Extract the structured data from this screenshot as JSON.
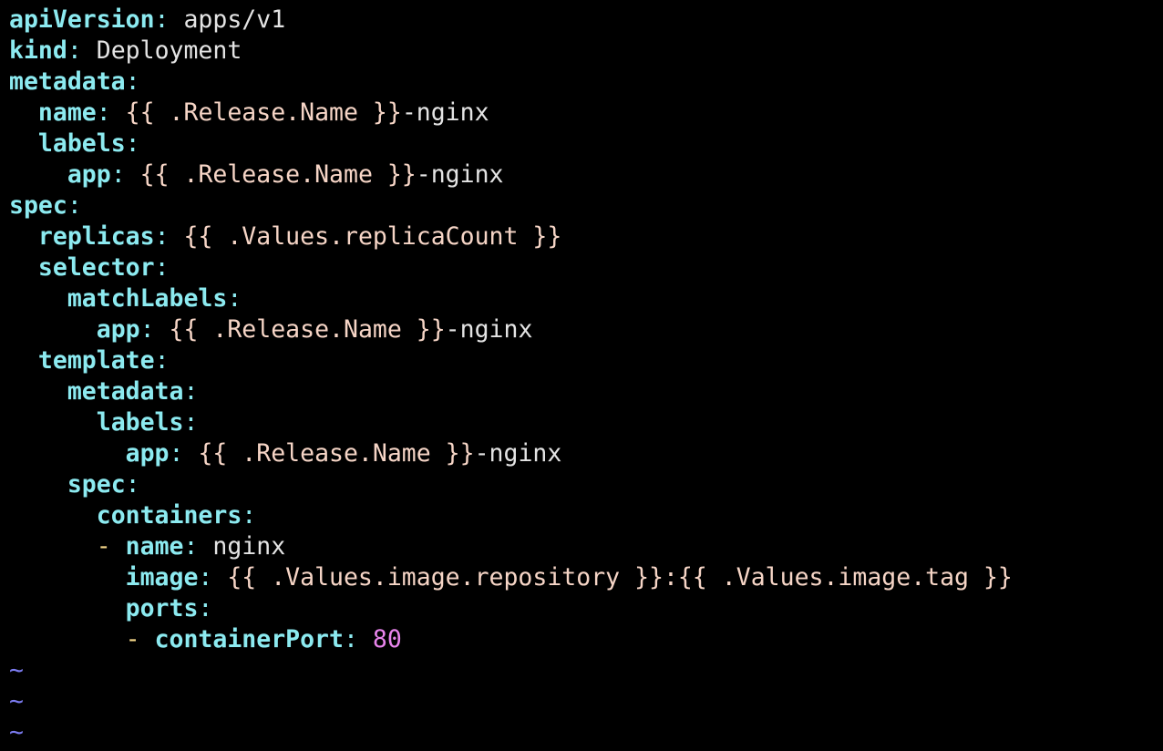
{
  "editor": {
    "lines": [
      {
        "indent": "",
        "dash": "",
        "key": "apiVersion",
        "colon": ":",
        "tpl": "",
        "value": " apps/v1",
        "number": ""
      },
      {
        "indent": "",
        "dash": "",
        "key": "kind",
        "colon": ":",
        "tpl": "",
        "value": " Deployment",
        "number": ""
      },
      {
        "indent": "",
        "dash": "",
        "key": "metadata",
        "colon": ":",
        "tpl": "",
        "value": "",
        "number": ""
      },
      {
        "indent": "  ",
        "dash": "",
        "key": "name",
        "colon": ":",
        "tpl": " {{ .Release.Name }}",
        "value": "-nginx",
        "number": ""
      },
      {
        "indent": "  ",
        "dash": "",
        "key": "labels",
        "colon": ":",
        "tpl": "",
        "value": "",
        "number": ""
      },
      {
        "indent": "    ",
        "dash": "",
        "key": "app",
        "colon": ":",
        "tpl": " {{ .Release.Name }}",
        "value": "-nginx",
        "number": ""
      },
      {
        "indent": "",
        "dash": "",
        "key": "spec",
        "colon": ":",
        "tpl": "",
        "value": "",
        "number": ""
      },
      {
        "indent": "  ",
        "dash": "",
        "key": "replicas",
        "colon": ":",
        "tpl": " {{ .Values.replicaCount }}",
        "value": "",
        "number": ""
      },
      {
        "indent": "  ",
        "dash": "",
        "key": "selector",
        "colon": ":",
        "tpl": "",
        "value": "",
        "number": ""
      },
      {
        "indent": "    ",
        "dash": "",
        "key": "matchLabels",
        "colon": ":",
        "tpl": "",
        "value": "",
        "number": ""
      },
      {
        "indent": "      ",
        "dash": "",
        "key": "app",
        "colon": ":",
        "tpl": " {{ .Release.Name }}",
        "value": "-nginx",
        "number": ""
      },
      {
        "indent": "  ",
        "dash": "",
        "key": "template",
        "colon": ":",
        "tpl": "",
        "value": "",
        "number": ""
      },
      {
        "indent": "    ",
        "dash": "",
        "key": "metadata",
        "colon": ":",
        "tpl": "",
        "value": "",
        "number": ""
      },
      {
        "indent": "      ",
        "dash": "",
        "key": "labels",
        "colon": ":",
        "tpl": "",
        "value": "",
        "number": ""
      },
      {
        "indent": "        ",
        "dash": "",
        "key": "app",
        "colon": ":",
        "tpl": " {{ .Release.Name }}",
        "value": "-nginx",
        "number": ""
      },
      {
        "indent": "    ",
        "dash": "",
        "key": "spec",
        "colon": ":",
        "tpl": "",
        "value": "",
        "number": ""
      },
      {
        "indent": "      ",
        "dash": "",
        "key": "containers",
        "colon": ":",
        "tpl": "",
        "value": "",
        "number": ""
      },
      {
        "indent": "      ",
        "dash": "- ",
        "key": "name",
        "colon": ":",
        "tpl": "",
        "value": " nginx",
        "number": ""
      },
      {
        "indent": "        ",
        "dash": "",
        "key": "image",
        "colon": ":",
        "tpl": " {{ .Values.image.repository }}:{{ .Values.image.tag }}",
        "value": "",
        "number": ""
      },
      {
        "indent": "        ",
        "dash": "",
        "key": "ports",
        "colon": ":",
        "tpl": "",
        "value": "",
        "number": ""
      },
      {
        "indent": "        ",
        "dash": "- ",
        "key": "containerPort",
        "colon": ":",
        "tpl": "",
        "value": "",
        "number": " 80"
      }
    ],
    "empty_line_marker": "~",
    "empty_line_count": 3
  },
  "colors": {
    "background": "#000000",
    "key": "#8CEAF0",
    "plain_value": "#E4E4E4",
    "template_expression": "#F6D5C6",
    "list_dash": "#F6D88A",
    "number": "#E884EC",
    "tilde": "#7C7CF2"
  }
}
